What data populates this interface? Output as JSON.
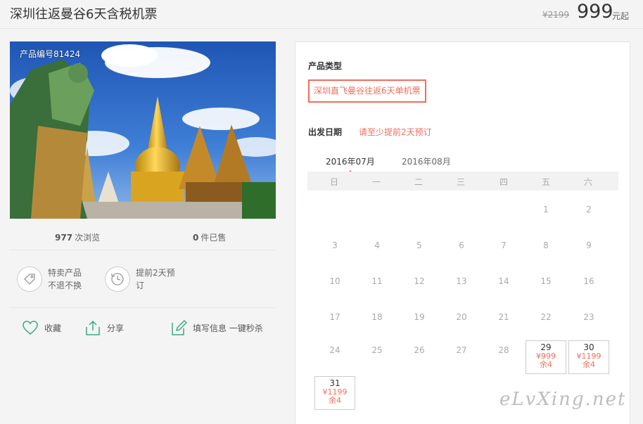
{
  "header": {
    "title": "深圳往返曼谷6天含税机票",
    "price_old": "¥2199",
    "price": "999",
    "price_unit": "元起"
  },
  "photo": {
    "product_code": "产品编号81424"
  },
  "stats": {
    "views_count": "977",
    "views_label": "次浏览",
    "sold_count": "0",
    "sold_label": "件已售"
  },
  "features": [
    {
      "icon": "tag-icon",
      "line1": "特卖产品",
      "line2": "不退不换"
    },
    {
      "icon": "clock-icon",
      "line1": "提前2天预",
      "line2": "订"
    }
  ],
  "actions": {
    "favorite": "收藏",
    "share": "分享",
    "fill_info": "填写信息 一键秒杀"
  },
  "panel": {
    "product_type_label": "产品类型",
    "product_type_value": "深圳直飞曼谷往返6天单机票",
    "depart_label": "出发日期",
    "depart_note": "请至少提前2天预订"
  },
  "calendar": {
    "months": [
      "2016年07月",
      "2016年08月"
    ],
    "active_month_index": 0,
    "weekdays": [
      "日",
      "一",
      "二",
      "三",
      "四",
      "五",
      "六"
    ],
    "days": [
      {
        "day": "1"
      },
      {
        "day": "2"
      },
      {
        "day": "3"
      },
      {
        "day": "4"
      },
      {
        "day": "5"
      },
      {
        "day": "6"
      },
      {
        "day": "7"
      },
      {
        "day": "8"
      },
      {
        "day": "9"
      },
      {
        "day": "10"
      },
      {
        "day": "11"
      },
      {
        "day": "12"
      },
      {
        "day": "13"
      },
      {
        "day": "14"
      },
      {
        "day": "15"
      },
      {
        "day": "16"
      },
      {
        "day": "17"
      },
      {
        "day": "18"
      },
      {
        "day": "19"
      },
      {
        "day": "20"
      },
      {
        "day": "21"
      },
      {
        "day": "22"
      },
      {
        "day": "23"
      },
      {
        "day": "24"
      },
      {
        "day": "25"
      },
      {
        "day": "26"
      },
      {
        "day": "27"
      },
      {
        "day": "28"
      },
      {
        "day": "29",
        "price": "¥999",
        "left": "余4"
      },
      {
        "day": "30",
        "price": "¥1199",
        "left": "余4"
      },
      {
        "day": "31",
        "price": "¥1199",
        "left": "余4"
      }
    ],
    "first_weekday_index": 5
  },
  "watermark": "eLvXing.net",
  "colors": {
    "accent": "#f26d5b",
    "icon_green": "#3aaa85"
  }
}
